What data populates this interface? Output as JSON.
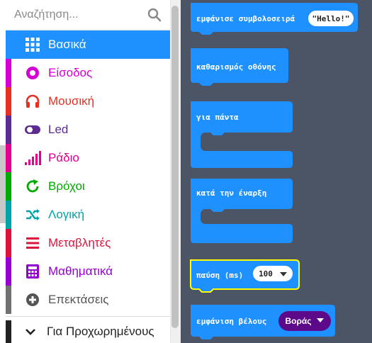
{
  "search": {
    "placeholder": "Αναζήτηση..."
  },
  "categories": [
    {
      "label": "Βασικά",
      "color": "#1e90ff",
      "icon": "grid-icon",
      "selected": true
    },
    {
      "label": "Είσοδος",
      "color": "#d400d4",
      "icon": "input-icon"
    },
    {
      "label": "Μουσική",
      "color": "#e63022",
      "icon": "headphones-icon"
    },
    {
      "label": "Led",
      "color": "#5c2d91",
      "icon": "toggle-icon"
    },
    {
      "label": "Ράδιο",
      "color": "#e3008c",
      "icon": "signal-bars-icon"
    },
    {
      "label": "Βρόχοι",
      "color": "#00aa00",
      "icon": "refresh-icon"
    },
    {
      "label": "Λογική",
      "color": "#00a4a6",
      "icon": "shuffle-icon"
    },
    {
      "label": "Μεταβλητές",
      "color": "#dc143c",
      "icon": "list-lines-icon"
    },
    {
      "label": "Μαθηματικά",
      "color": "#9400d3",
      "icon": "calculator-icon"
    },
    {
      "label": "Επεκτάσεις",
      "color": "#717171",
      "icon": "plus-circle-icon"
    }
  ],
  "advanced": {
    "label": "Για Προχωρημένους",
    "icon": "chevron-down-icon"
  },
  "blocks": {
    "show_string": {
      "label": "εμφάνισε συμβολοσειρά",
      "value": "Hello!"
    },
    "clear_screen": {
      "label": "καθαρισμός οθόνης"
    },
    "forever": {
      "label": "για πάντα"
    },
    "on_start": {
      "label": "κατά την έναρξη"
    },
    "pause": {
      "label": "παύση (ms)",
      "value": "100"
    },
    "show_arrow": {
      "label": "εμφάνιση βέλους",
      "value": "Βοράς"
    }
  },
  "colors": {
    "block_blue": "#1e90ff",
    "workspace": "#4c5566",
    "highlight": "#ffff00",
    "dropdown_purple": "#5c0a8a"
  }
}
